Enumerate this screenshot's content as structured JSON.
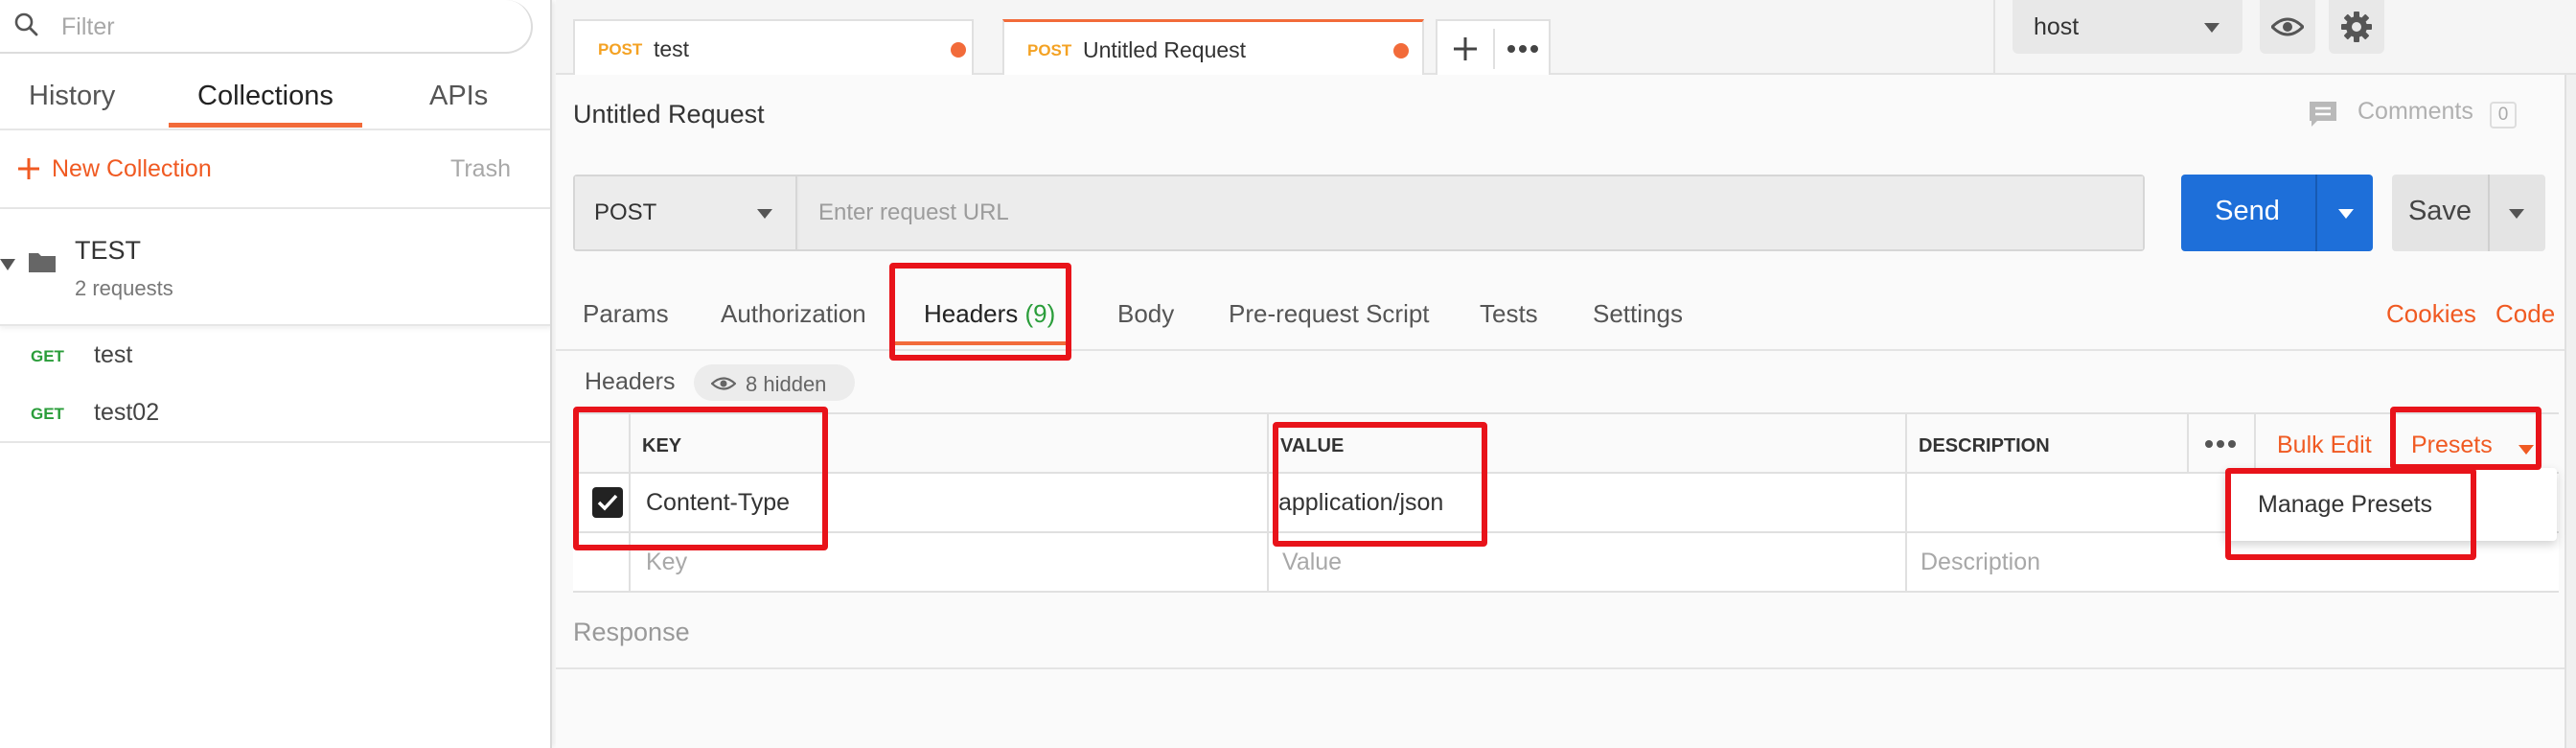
{
  "sidebar": {
    "filter_placeholder": "Filter",
    "tabs": [
      {
        "label": "History"
      },
      {
        "label": "Collections"
      },
      {
        "label": "APIs"
      }
    ],
    "new_collection_label": "New Collection",
    "trash_label": "Trash",
    "collection": {
      "name": "TEST",
      "count": "2 requests"
    },
    "requests": [
      {
        "method": "GET",
        "name": "test"
      },
      {
        "method": "GET",
        "name": "test02"
      }
    ]
  },
  "tabs": [
    {
      "method": "POST",
      "name": "test"
    },
    {
      "method": "POST",
      "name": "Untitled Request"
    }
  ],
  "environment": {
    "selected": "host"
  },
  "request": {
    "title": "Untitled Request",
    "comments_label": "Comments",
    "comments_count": "0",
    "method": "POST",
    "url_placeholder": "Enter request URL",
    "url_value": "",
    "send_label": "Send",
    "save_label": "Save"
  },
  "sub_tabs": {
    "params": "Params",
    "authorization": "Authorization",
    "headers": "Headers",
    "headers_count": "(9)",
    "body": "Body",
    "prerequest": "Pre-request Script",
    "tests": "Tests",
    "settings": "Settings",
    "cookies": "Cookies",
    "code": "Code"
  },
  "headers_section": {
    "label": "Headers",
    "hidden_label": "8 hidden",
    "columns": {
      "key": "KEY",
      "value": "VALUE",
      "description": "DESCRIPTION"
    },
    "bulk_edit": "Bulk Edit",
    "presets": "Presets",
    "rows": [
      {
        "key": "Content-Type",
        "value": "application/json",
        "description": "",
        "checked": true
      }
    ],
    "placeholders": {
      "key": "Key",
      "value": "Value",
      "description": "Description"
    }
  },
  "presets_menu": {
    "items": [
      "Manage Presets"
    ]
  },
  "response_label": "Response",
  "colors": {
    "accent": "#f26b3a",
    "send": "#1e6fd9",
    "get": "#2a9d3a",
    "post": "#f4a223",
    "highlight": "#e8131a"
  }
}
